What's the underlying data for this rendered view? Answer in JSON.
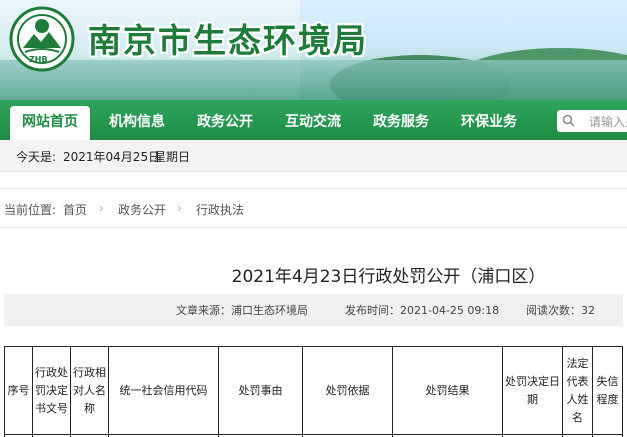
{
  "header": {
    "site_title": "南京市生态环境局",
    "logo_text": "ZHB"
  },
  "nav": {
    "items": [
      "网站首页",
      "机构信息",
      "政务公开",
      "互动交流",
      "政务服务",
      "环保业务"
    ],
    "active_index": 0,
    "search_placeholder": "请输入关"
  },
  "datebar": {
    "label": "今天是:",
    "date": "2021年04月25日",
    "weekday": "星期日"
  },
  "breadcrumb": {
    "label": "当前位置:",
    "items": [
      "首页",
      "政务公开",
      "行政执法"
    ]
  },
  "article": {
    "title": "2021年4月23日行政处罚公开（浦口区）",
    "source": "文章来源：浦口生态环境局",
    "published": "发布时间：2021-04-25 09:18",
    "views": "阅读次数：32"
  },
  "table": {
    "headers": [
      "序号",
      "行政处罚决定书文号",
      "行政相对人名称",
      "统一社会信用代码",
      "处罚事由",
      "处罚依据",
      "处罚结果",
      "处罚决定日期",
      "法定代表人姓名",
      "失信程度"
    ]
  },
  "colors": {
    "nav_green": "#1d8b44",
    "title_green": "#1e7b3a"
  }
}
